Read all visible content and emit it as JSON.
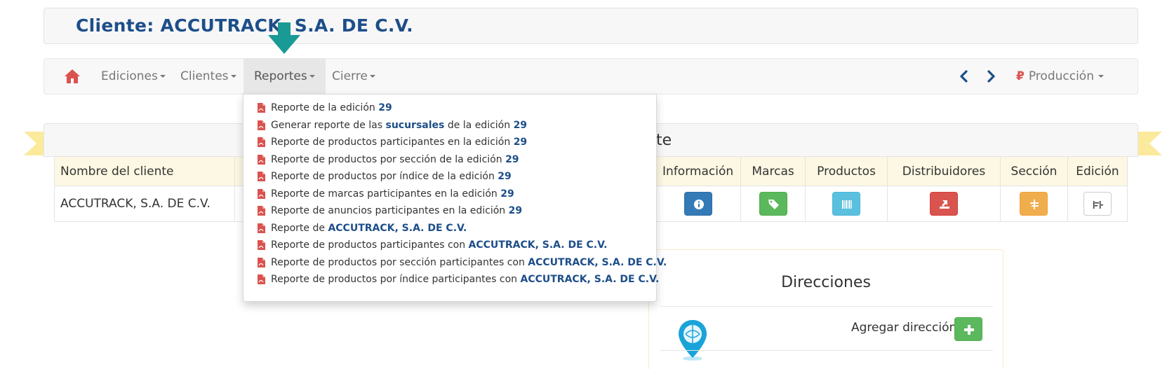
{
  "header": {
    "title": "Cliente: ACCUTRACK, S.A. DE C.V."
  },
  "navbar": {
    "home_icon": "home-icon",
    "menus": [
      {
        "label": "Ediciones"
      },
      {
        "label": "Clientes"
      },
      {
        "label": "Reportes"
      },
      {
        "label": "Cierre"
      }
    ],
    "prev_icon": "chevron-left-icon",
    "next_icon": "chevron-right-icon",
    "env_symbol": "₽",
    "env_label": "Producción"
  },
  "reportes_menu": {
    "items": [
      {
        "text": "Reporte de la edición ",
        "bold": "29",
        "after": ""
      },
      {
        "text": "Generar reporte de las ",
        "bold": "sucursales",
        "after": " de la edición ",
        "bold2": "29"
      },
      {
        "text": "Reporte de productos participantes en la edición ",
        "bold": "29",
        "after": ""
      },
      {
        "text": "Reporte de productos por sección de la edición ",
        "bold": "29",
        "after": ""
      },
      {
        "text": "Reporte de productos por índice de la edición ",
        "bold": "29",
        "after": ""
      },
      {
        "text": "Reporte de marcas participantes en la edición ",
        "bold": "29",
        "after": ""
      },
      {
        "text": "Reporte de anuncios participantes en la edición ",
        "bold": "29",
        "after": ""
      },
      {
        "text": "Reporte de ",
        "bold": "ACCUTRACK, S.A. DE C.V.",
        "after": ""
      },
      {
        "text": "Reporte de productos participantes con ",
        "bold": "ACCUTRACK, S.A. DE C.V.",
        "after": ""
      },
      {
        "text": "Reporte de productos por sección participantes con ",
        "bold": "ACCUTRACK, S.A. DE C.V.",
        "after": ""
      },
      {
        "text": "Reporte de productos por índice participantes con ",
        "bold": "ACCUTRACK, S.A. DE C.V.",
        "after": ""
      }
    ]
  },
  "section": {
    "title_visible": "nte"
  },
  "table": {
    "headers": [
      "Nombre del cliente",
      "Información",
      "Marcas",
      "Productos",
      "Distribuidores",
      "Sección",
      "Edición"
    ],
    "row": {
      "name": "ACCUTRACK, S.A. DE C.V."
    }
  },
  "direcciones": {
    "title": "Direcciones",
    "add_label": "Agregar dirección"
  },
  "colors": {
    "title_blue": "#1d4e89",
    "ribbon": "#fcea9c",
    "teal": "#1a9a94"
  }
}
